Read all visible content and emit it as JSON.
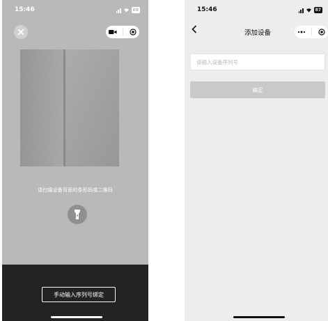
{
  "scan_screen": {
    "status_time": "15:46",
    "battery": "88",
    "hint": "请扫描设备背面的条形码或二维码",
    "manual_button": "手动输入序列号绑定",
    "icons": [
      "close-icon",
      "video-icon",
      "record-icon",
      "flashlight-icon",
      "signal-icon",
      "wifi-icon",
      "battery-icon"
    ]
  },
  "add_screen": {
    "status_time": "15:46",
    "battery": "87",
    "title": "添加设备",
    "input_placeholder": "请输入设备序列号",
    "input_value": "",
    "confirm_button": "确定",
    "icons": [
      "back-icon",
      "more-icon",
      "record-icon",
      "signal-icon",
      "wifi-icon",
      "battery-icon"
    ]
  },
  "colors": {
    "scan_background": "#b8b9bb",
    "bottom_bar": "#232323",
    "page_background": "#ededed",
    "confirm_disabled": "#c9c9c9"
  }
}
